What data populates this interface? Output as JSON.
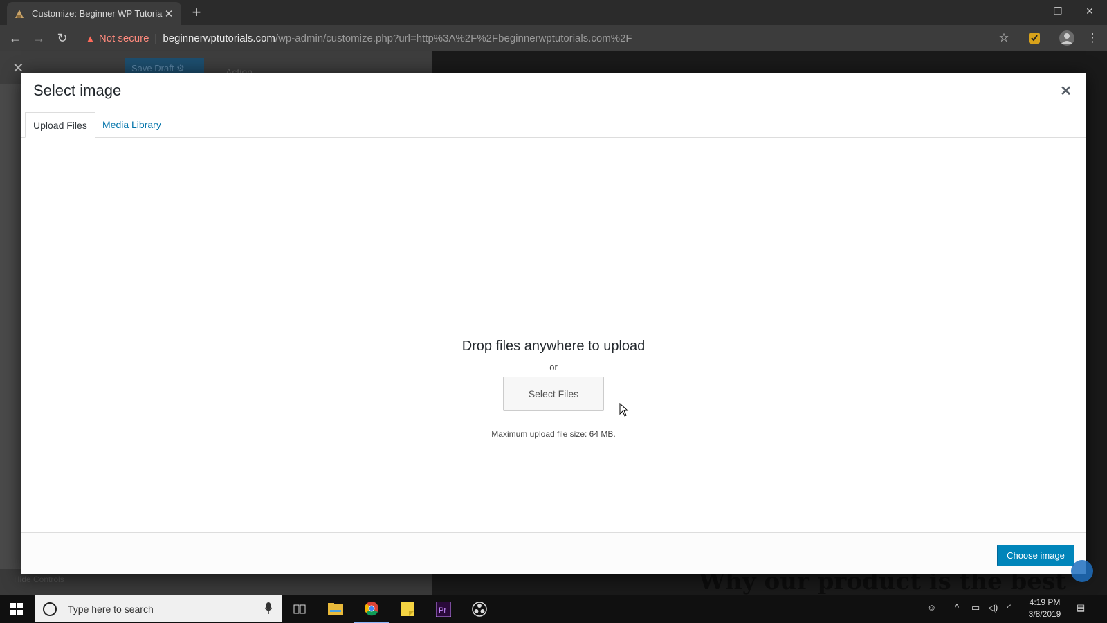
{
  "browser": {
    "tab_title": "Customize: Beginner WP Tutorial",
    "security_label": "Not secure",
    "url_host": "beginnerwptutorials.com",
    "url_path": "/wp-admin/customize.php?url=http%3A%2F%2Fbeginnerwptutorials.com%2F"
  },
  "customizer": {
    "save_label": "Save Draft",
    "action_label": "Action",
    "hide_controls_label": "Hide Controls",
    "preview_headline": "Why our product is the best"
  },
  "modal": {
    "title": "Select image",
    "tabs": [
      {
        "label": "Upload Files",
        "active": true
      },
      {
        "label": "Media Library",
        "active": false
      }
    ],
    "drop_title": "Drop files anywhere to upload",
    "or_text": "or",
    "select_files_label": "Select Files",
    "max_size_text": "Maximum upload file size: 64 MB.",
    "choose_button_label": "Choose image"
  },
  "taskbar": {
    "search_placeholder": "Type here to search",
    "time": "4:19 PM",
    "date": "3/8/2019"
  },
  "colors": {
    "accent": "#0085ba",
    "link": "#0073aa"
  }
}
